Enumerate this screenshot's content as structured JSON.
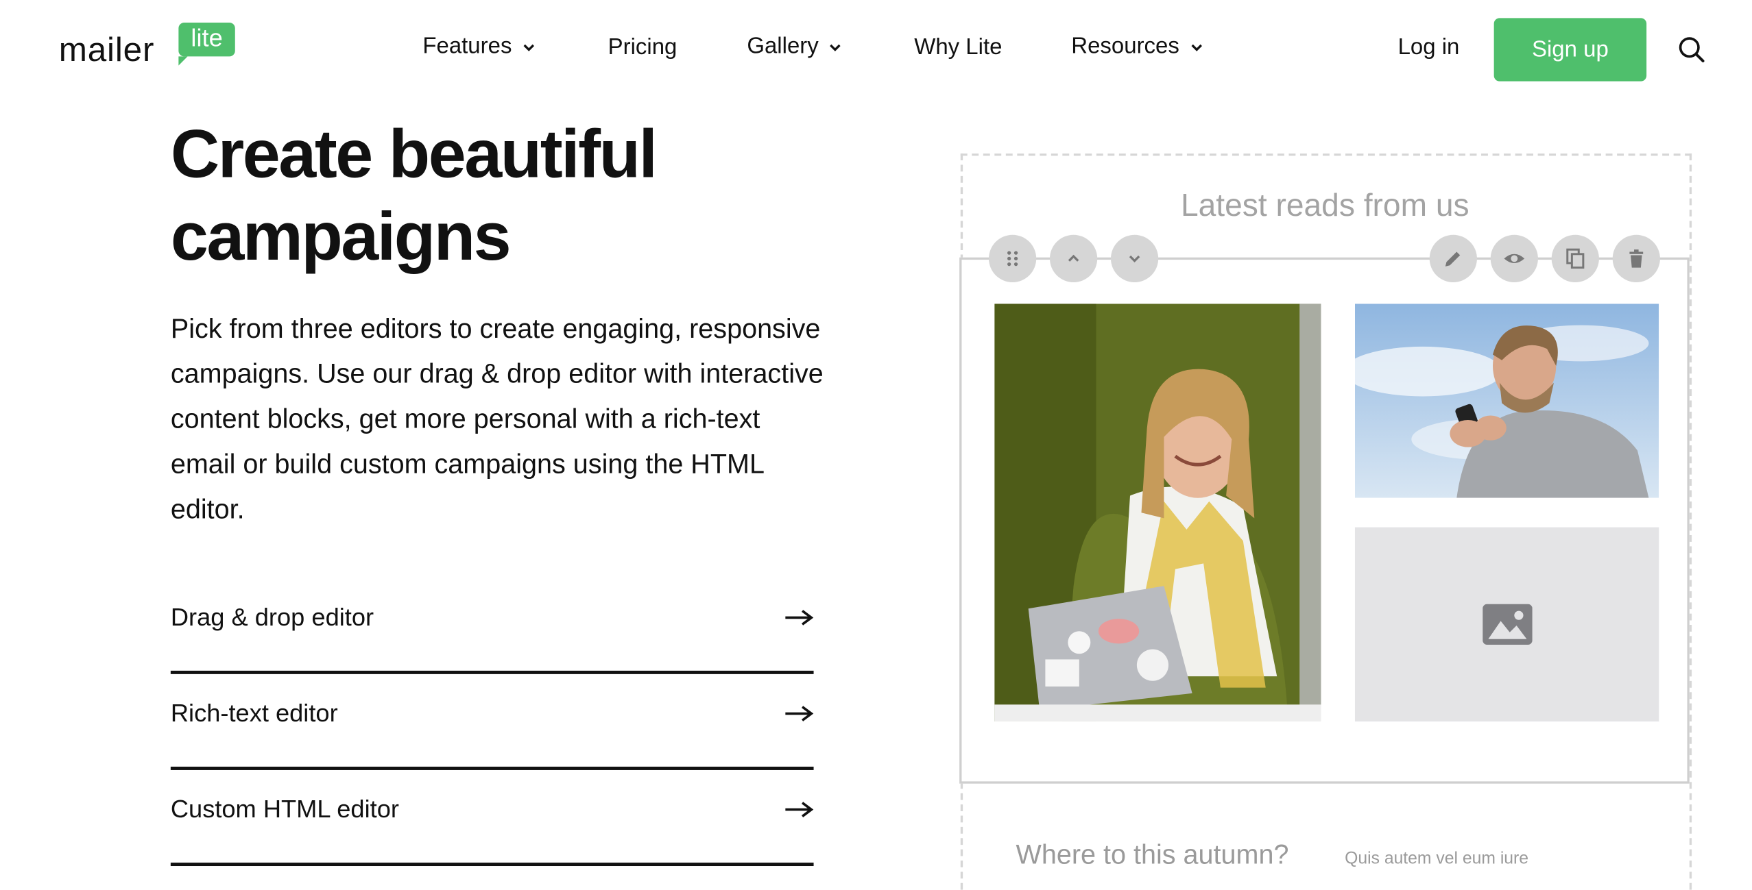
{
  "header": {
    "logo_word": "mailer",
    "logo_badge": "lite",
    "nav": [
      {
        "label": "Features",
        "has_dropdown": true
      },
      {
        "label": "Pricing",
        "has_dropdown": false
      },
      {
        "label": "Gallery",
        "has_dropdown": true
      },
      {
        "label": "Why Lite",
        "has_dropdown": false
      },
      {
        "label": "Resources",
        "has_dropdown": true
      }
    ],
    "login_label": "Log in",
    "signup_label": "Sign up",
    "search_icon": "search-icon"
  },
  "hero": {
    "title_line1": "Create beautiful",
    "title_line2": "campaigns",
    "description": "Pick from three editors to create engaging, responsive campaigns. Use our drag & drop editor with interactive content blocks, get more personal with a rich-text email or build custom campaigns using the HTML editor."
  },
  "editors": [
    {
      "label": "Drag & drop editor"
    },
    {
      "label": "Rich-text editor"
    },
    {
      "label": "Custom HTML editor"
    }
  ],
  "preview": {
    "section_title": "Latest reads from us",
    "toolbar_left": [
      "drag-handle-icon",
      "chevron-up-icon",
      "chevron-down-icon"
    ],
    "toolbar_right": [
      "pencil-icon",
      "eye-icon",
      "copy-icon",
      "trash-icon"
    ],
    "teaser_title": "Where to this autumn?",
    "teaser_text": "Quis autem vel eum iure"
  },
  "colors": {
    "brand_green": "#4fbf6c",
    "text_dark": "#111111",
    "muted_gray": "#a3a3a3",
    "tool_gray": "#d6d6d6"
  }
}
